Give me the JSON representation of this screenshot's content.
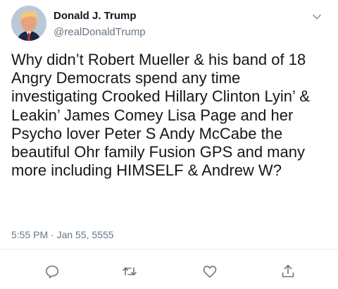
{
  "author": {
    "name": "Donald J. Trump",
    "handle": "@realDonaldTrump"
  },
  "tweet": {
    "text": "Why didn’t Robert Mueller & his band of 18 Angry Democrats spend any time investigating Crooked Hillary Clinton Lyin’ & Leakin’ James Comey Lisa Page and her Psycho lover Peter S Andy McCabe the beautiful Ohr family Fusion GPS and many more including HIMSELF & Andrew W?",
    "timestamp": "5:55 PM · Jan 55, 5555"
  },
  "icons": {
    "menu": "chevron-down-icon",
    "reply": "reply-icon",
    "retweet": "retweet-icon",
    "like": "heart-icon",
    "share": "share-icon"
  },
  "colors": {
    "text": "#14171a",
    "secondary": "#657786",
    "divider": "#e6ecf0"
  }
}
